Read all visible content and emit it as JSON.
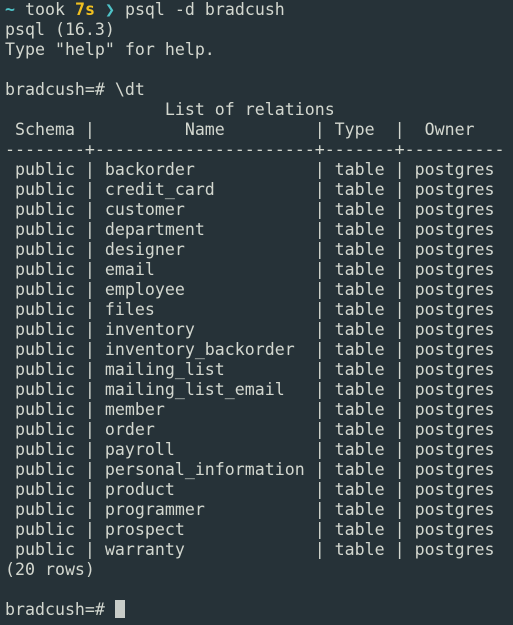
{
  "shell_prompt": {
    "dir": "~",
    "took_label": "took",
    "duration": "7s",
    "chevron": "❯",
    "command": "psql -d bradcush"
  },
  "banner": {
    "version_line": "psql (16.3)",
    "help_line": "Type \"help\" for help."
  },
  "db_prompt": "bradcush=#",
  "entered_command": "\\dt",
  "table": {
    "caption": "List of relations",
    "columns": [
      "Schema",
      "Name",
      "Type",
      "Owner"
    ],
    "rows": [
      {
        "schema": "public",
        "name": "backorder",
        "type": "table",
        "owner": "postgres"
      },
      {
        "schema": "public",
        "name": "credit_card",
        "type": "table",
        "owner": "postgres"
      },
      {
        "schema": "public",
        "name": "customer",
        "type": "table",
        "owner": "postgres"
      },
      {
        "schema": "public",
        "name": "department",
        "type": "table",
        "owner": "postgres"
      },
      {
        "schema": "public",
        "name": "designer",
        "type": "table",
        "owner": "postgres"
      },
      {
        "schema": "public",
        "name": "email",
        "type": "table",
        "owner": "postgres"
      },
      {
        "schema": "public",
        "name": "employee",
        "type": "table",
        "owner": "postgres"
      },
      {
        "schema": "public",
        "name": "files",
        "type": "table",
        "owner": "postgres"
      },
      {
        "schema": "public",
        "name": "inventory",
        "type": "table",
        "owner": "postgres"
      },
      {
        "schema": "public",
        "name": "inventory_backorder",
        "type": "table",
        "owner": "postgres"
      },
      {
        "schema": "public",
        "name": "mailing_list",
        "type": "table",
        "owner": "postgres"
      },
      {
        "schema": "public",
        "name": "mailing_list_email",
        "type": "table",
        "owner": "postgres"
      },
      {
        "schema": "public",
        "name": "member",
        "type": "table",
        "owner": "postgres"
      },
      {
        "schema": "public",
        "name": "order",
        "type": "table",
        "owner": "postgres"
      },
      {
        "schema": "public",
        "name": "payroll",
        "type": "table",
        "owner": "postgres"
      },
      {
        "schema": "public",
        "name": "personal_information",
        "type": "table",
        "owner": "postgres"
      },
      {
        "schema": "public",
        "name": "product",
        "type": "table",
        "owner": "postgres"
      },
      {
        "schema": "public",
        "name": "programmer",
        "type": "table",
        "owner": "postgres"
      },
      {
        "schema": "public",
        "name": "prospect",
        "type": "table",
        "owner": "postgres"
      },
      {
        "schema": "public",
        "name": "warranty",
        "type": "table",
        "owner": "postgres"
      }
    ],
    "footer": "(20 rows)"
  },
  "colors": {
    "background": "#263238",
    "foreground": "#d3d7cf",
    "prompt_accent": "#4fc3c8",
    "duration": "#f0c020",
    "cursor": "#c8ccc8"
  }
}
